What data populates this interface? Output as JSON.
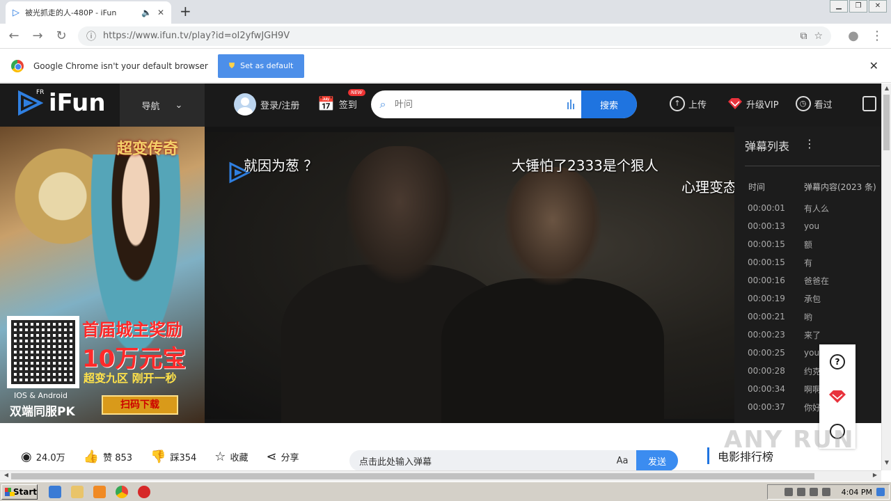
{
  "browser": {
    "tab_title": "被光抓走的人-480P - iFun",
    "url": "https://www.ifun.tv/play?id=oI2yfwJGH9V",
    "infobar_text": "Google Chrome isn't your default browser",
    "set_default_label": "Set as default"
  },
  "header": {
    "logo_text": "iFun",
    "logo_sup": "FR",
    "nav_label": "导航",
    "login_label": "登录/注册",
    "checkin_label": "签到",
    "new_badge": "NEW",
    "search_placeholder": "叶问",
    "search_button": "搜索",
    "upload_label": "上传",
    "vip_label": "升级VIP",
    "history_label": "看过"
  },
  "ad": {
    "title": "超变传奇",
    "headline1": "首届城主奖励",
    "headline2": "10万元宝",
    "headline3": "超变九区 刚开一秒",
    "scan_button": "扫码下载",
    "platform": "IOS & Android",
    "pk_text": "双端同服PK"
  },
  "video": {
    "danmu": [
      {
        "text": "就因为葱 ？"
      },
      {
        "text": "大锤怕了2333是个狠人"
      },
      {
        "text": "心理变态"
      }
    ]
  },
  "danmu_panel": {
    "title": "弹幕列表",
    "col_time": "时间",
    "col_content": "弹幕内容(2023 条)",
    "rows": [
      {
        "time": "00:00:01",
        "text": "有人么"
      },
      {
        "time": "00:00:13",
        "text": "you"
      },
      {
        "time": "00:00:15",
        "text": "额"
      },
      {
        "time": "00:00:15",
        "text": "有"
      },
      {
        "time": "00:00:16",
        "text": "爸爸在"
      },
      {
        "time": "00:00:19",
        "text": "承包"
      },
      {
        "time": "00:00:21",
        "text": "哟"
      },
      {
        "time": "00:00:23",
        "text": "来了"
      },
      {
        "time": "00:00:25",
        "text": "you"
      },
      {
        "time": "00:00:28",
        "text": "约克"
      },
      {
        "time": "00:00:34",
        "text": "啊啊"
      },
      {
        "time": "00:00:37",
        "text": "你好"
      }
    ]
  },
  "actions": {
    "views": "24.0万",
    "likes": "赞 853",
    "dislikes": "踩354",
    "favorite": "收藏",
    "share": "分享",
    "danmu_input_value": "点击此处输入弹幕",
    "font_label": "Aa",
    "send_label": "发送",
    "rank_title": "电影排行榜"
  },
  "watermark": "ANY RUN",
  "taskbar": {
    "start_label": "Start",
    "clock": "4:04 PM"
  }
}
